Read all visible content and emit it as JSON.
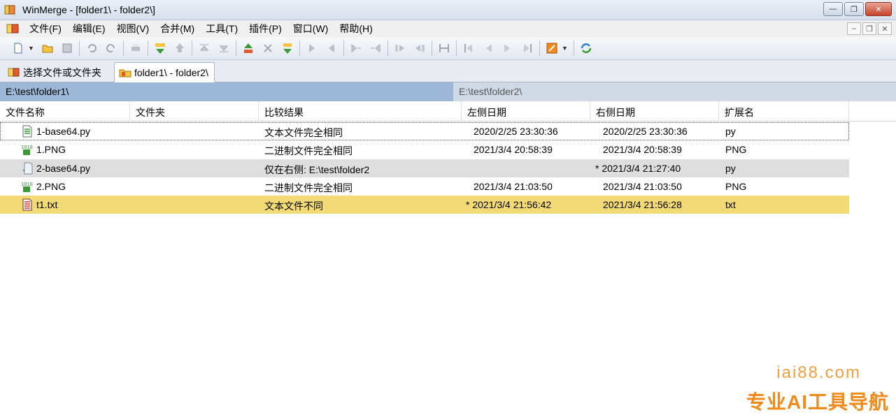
{
  "window": {
    "title": "WinMerge - [folder1\\ - folder2\\]"
  },
  "menu": {
    "items": [
      "文件(F)",
      "编辑(E)",
      "视图(V)",
      "合并(M)",
      "工具(T)",
      "插件(P)",
      "窗口(W)",
      "帮助(H)"
    ]
  },
  "tabs": [
    {
      "label": "选择文件或文件夹"
    },
    {
      "label": "folder1\\ - folder2\\"
    }
  ],
  "paths": {
    "left": "E:\\test\\folder1\\",
    "right": "E:\\test\\folder2\\"
  },
  "columns": [
    "文件名称",
    "文件夹",
    "比较结果",
    "左侧日期",
    "右侧日期",
    "扩展名"
  ],
  "rows": [
    {
      "name": "1-base64.py",
      "folder": "",
      "result": "文本文件完全相同",
      "left_date": "2020/2/25 23:30:36",
      "right_date": "2020/2/25 23:30:36",
      "ext": "py",
      "icon": "text-equal-icon"
    },
    {
      "name": "1.PNG",
      "folder": "",
      "result": "二进制文件完全相同",
      "left_date": "2021/3/4 20:58:39",
      "right_date": "2021/3/4 20:58:39",
      "ext": "PNG",
      "icon": "binary-equal-icon"
    },
    {
      "name": "2-base64.py",
      "folder": "",
      "result": "仅在右侧: E:\\test\\folder2",
      "left_date": "",
      "right_date": "* 2021/3/4 21:27:40",
      "ext": "py",
      "icon": "right-only-icon"
    },
    {
      "name": "2.PNG",
      "folder": "",
      "result": "二进制文件完全相同",
      "left_date": "2021/3/4 21:03:50",
      "right_date": "2021/3/4 21:03:50",
      "ext": "PNG",
      "icon": "binary-equal-icon"
    },
    {
      "name": "t1.txt",
      "folder": "",
      "result": "文本文件不同",
      "left_date": "* 2021/3/4 21:56:42",
      "right_date": "2021/3/4 21:56:28",
      "ext": "txt",
      "icon": "text-diff-icon"
    }
  ],
  "watermark": {
    "line1": "iai88.com",
    "line2": "专业AI工具导航"
  }
}
